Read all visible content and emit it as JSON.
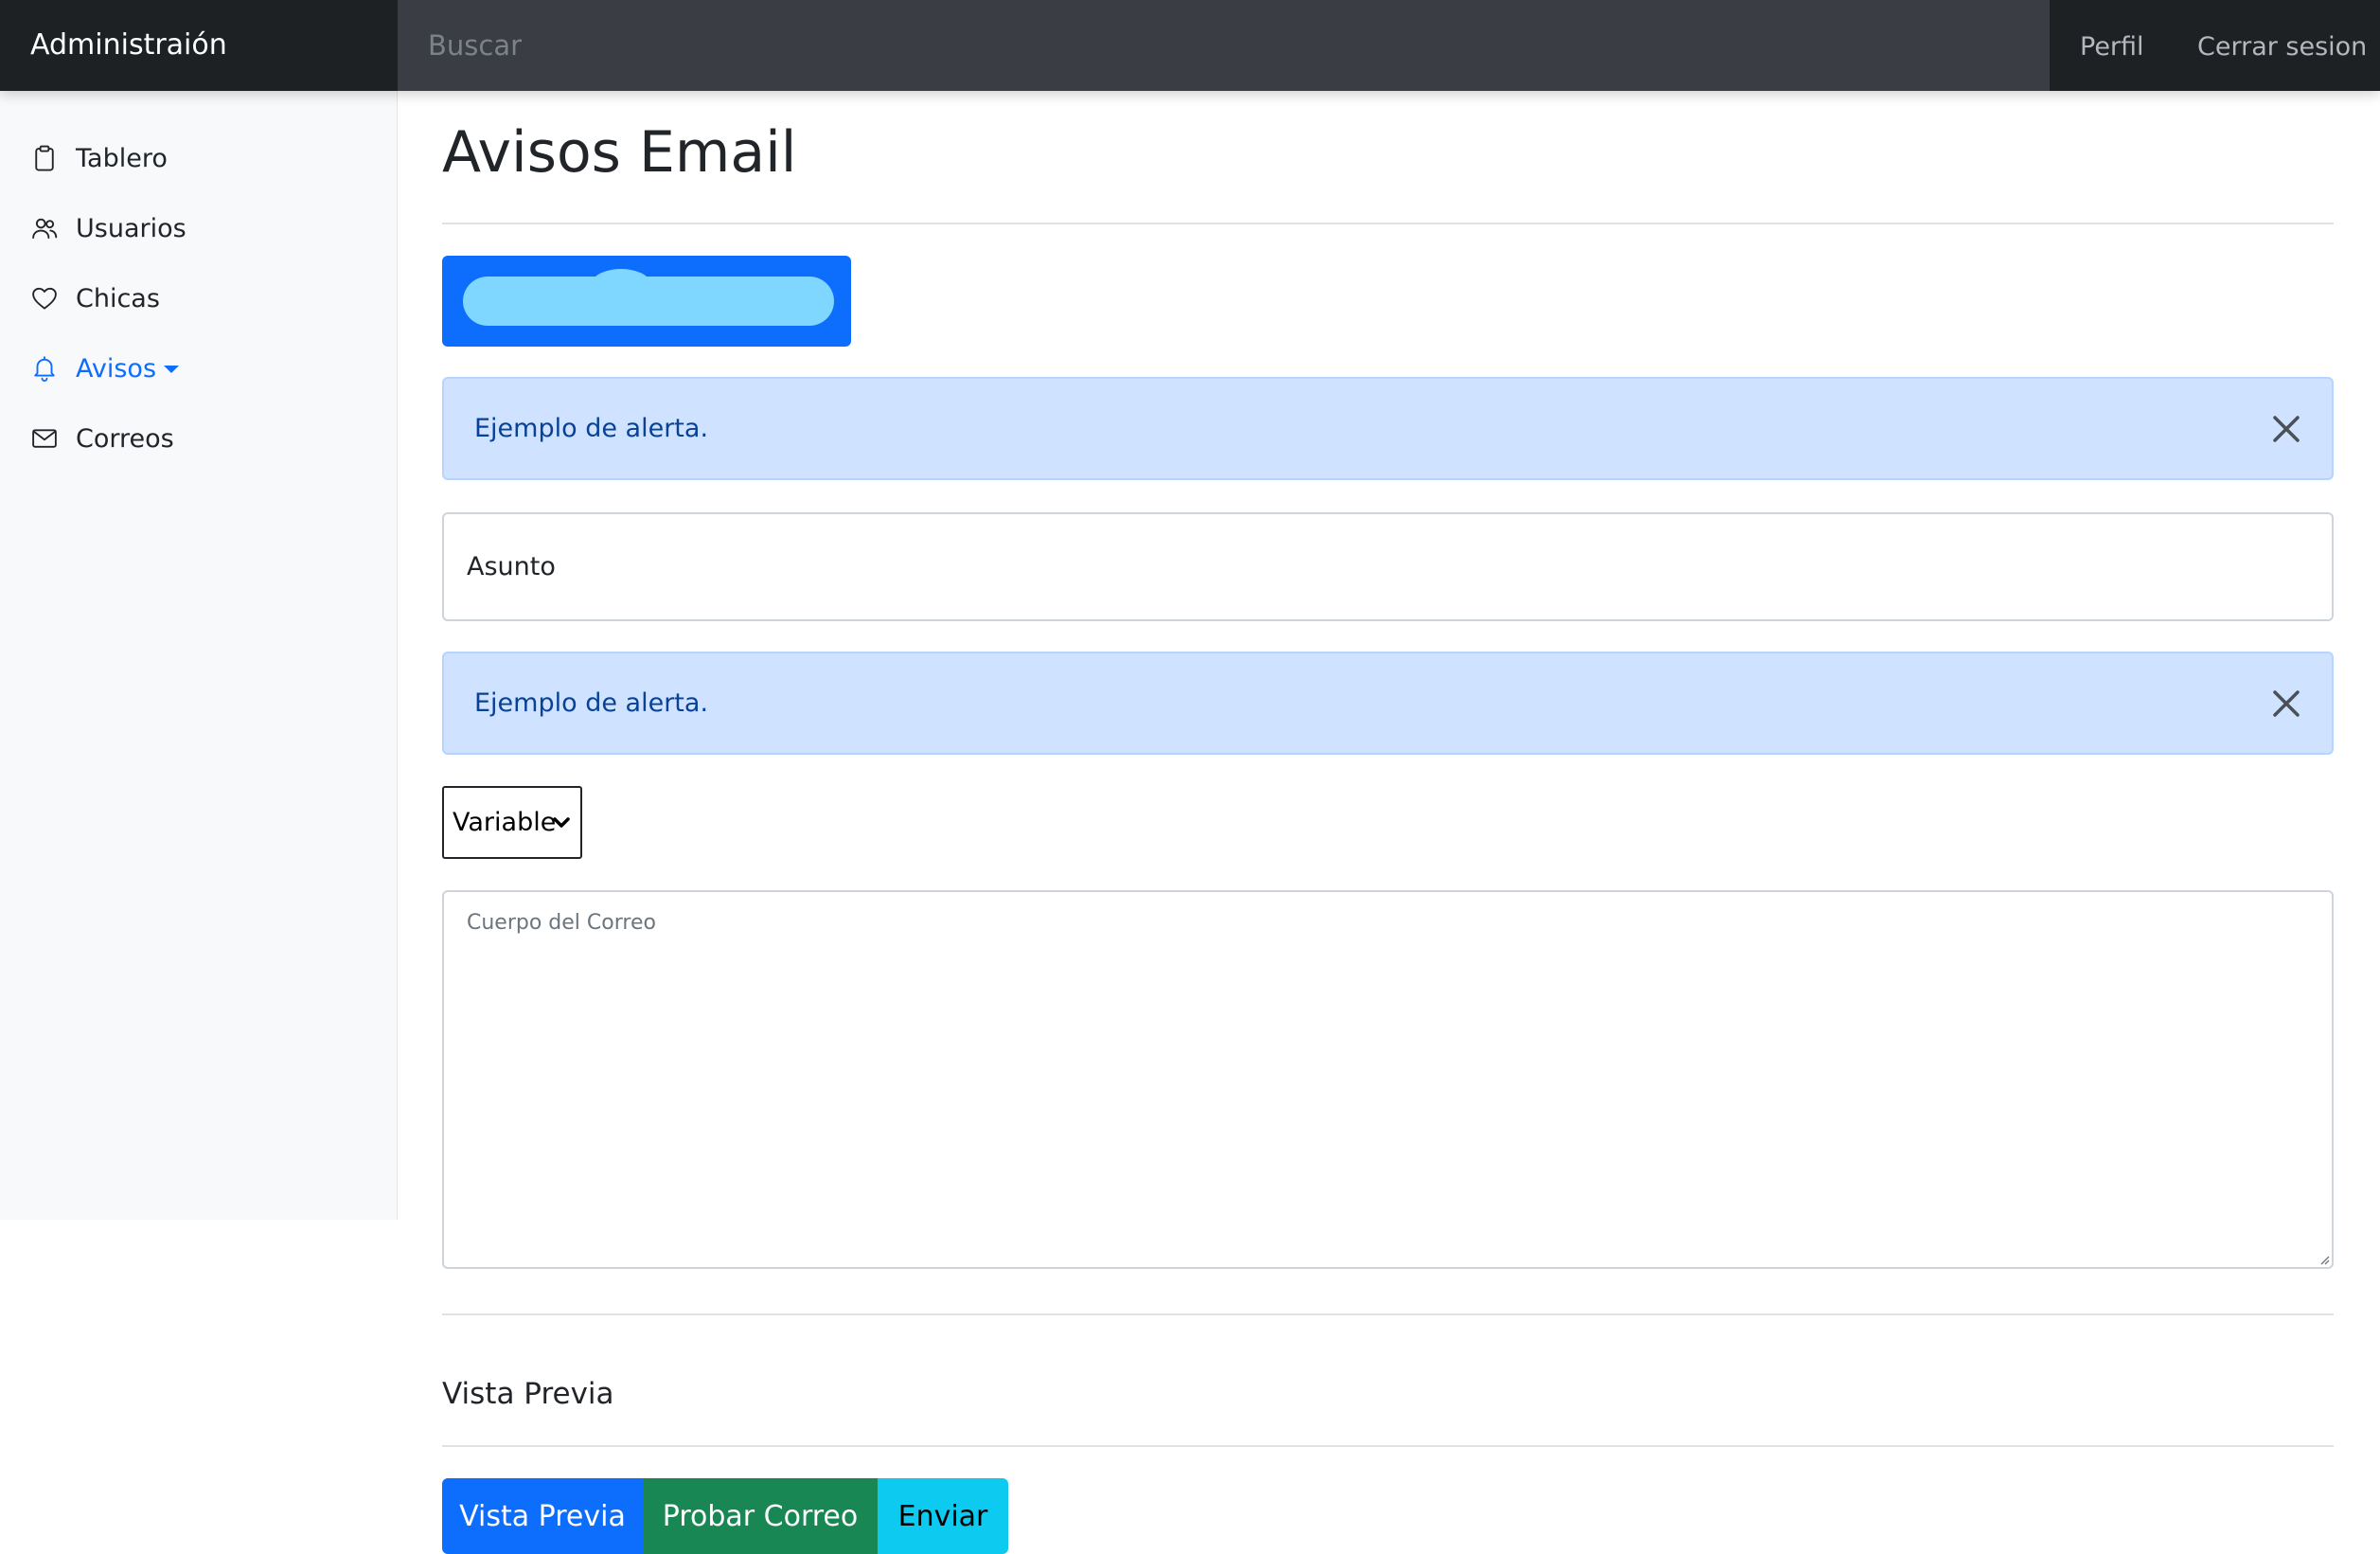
{
  "navbar": {
    "brand": "Administraión",
    "search_placeholder": "Buscar",
    "links": {
      "profile": "Perfil",
      "logout": "Cerrar sesion"
    }
  },
  "sidebar": {
    "items": [
      {
        "label": "Tablero",
        "icon": "clipboard-icon",
        "active": false
      },
      {
        "label": "Usuarios",
        "icon": "users-icon",
        "active": false
      },
      {
        "label": "Chicas",
        "icon": "heart-icon",
        "active": false
      },
      {
        "label": "Avisos",
        "icon": "bell-icon",
        "active": true,
        "dropdown": true
      },
      {
        "label": "Correos",
        "icon": "envelope-icon",
        "active": false
      }
    ]
  },
  "main": {
    "title": "Avisos Email",
    "redacted_button": {
      "label": "",
      "redacted": true
    },
    "alerts": [
      {
        "text": "Ejemplo de alerta."
      },
      {
        "text": "Ejemplo de alerta."
      }
    ],
    "subject_label": "Asunto",
    "variable_select": {
      "selected": "Variable"
    },
    "body_placeholder": "Cuerpo del Correo",
    "preview_heading": "Vista Previa",
    "buttons": {
      "preview": "Vista Previa",
      "test": "Probar Correo",
      "send": "Enviar"
    }
  },
  "colors": {
    "navbar_bg": "#343a40",
    "brand_bg": "#1e2124",
    "sidebar_bg": "#f8f9fa",
    "primary": "#0d6efd",
    "success": "#198754",
    "info": "#0dcaf0",
    "alert_bg": "#cfe2ff",
    "alert_text": "#084298",
    "redaction": "#7fd6ff"
  }
}
